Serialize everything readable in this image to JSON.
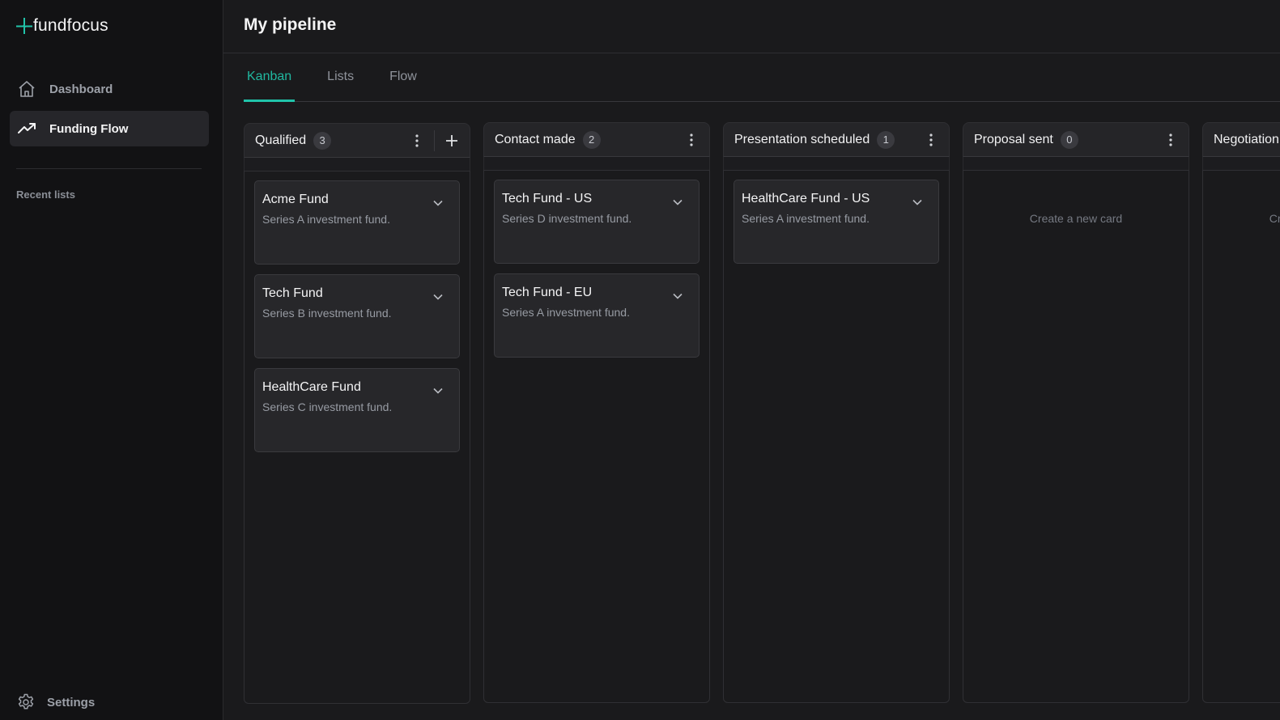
{
  "app": {
    "brand": "fundfocus",
    "brand_color": "#21c4aa"
  },
  "sidebar": {
    "nav": [
      {
        "label": "Dashboard",
        "icon": "home-icon",
        "active": false
      },
      {
        "label": "Funding Flow",
        "icon": "trending-up-icon",
        "active": true
      }
    ],
    "recent_label": "Recent lists",
    "settings_label": "Settings"
  },
  "page": {
    "title": "My pipeline",
    "tabs": [
      {
        "label": "Kanban",
        "active": true
      },
      {
        "label": "Lists",
        "active": false
      },
      {
        "label": "Flow",
        "active": false
      }
    ]
  },
  "board": {
    "empty_text": "Create a new card",
    "columns": [
      {
        "title": "Qualified",
        "count": "3",
        "cards": [
          {
            "title": "Acme Fund",
            "desc": "Series A investment fund."
          },
          {
            "title": "Tech Fund",
            "desc": "Series B investment fund."
          },
          {
            "title": "HealthCare Fund",
            "desc": "Series C investment fund."
          }
        ]
      },
      {
        "title": "Contact made",
        "count": "2",
        "cards": [
          {
            "title": "Tech Fund - US",
            "desc": "Series D investment fund."
          },
          {
            "title": "Tech Fund - EU",
            "desc": "Series A investment fund."
          }
        ]
      },
      {
        "title": "Presentation scheduled",
        "count": "1",
        "cards": [
          {
            "title": "HealthCare Fund - US",
            "desc": "Series A investment fund."
          }
        ]
      },
      {
        "title": "Proposal sent",
        "count": "0",
        "cards": []
      },
      {
        "title": "Negotiation",
        "cards": []
      }
    ]
  }
}
